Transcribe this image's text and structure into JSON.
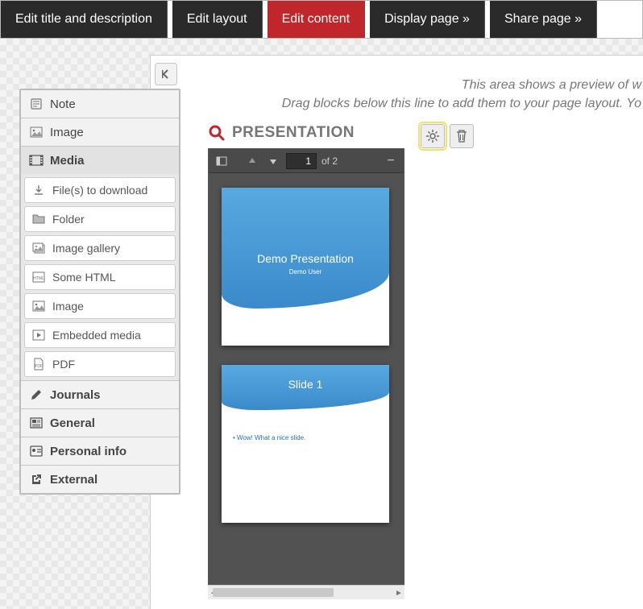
{
  "nav": {
    "tabs": [
      {
        "label": "Edit title and description",
        "active": false
      },
      {
        "label": "Edit layout",
        "active": false
      },
      {
        "label": "Edit content",
        "active": true
      },
      {
        "label": "Display page »",
        "active": false
      },
      {
        "label": "Share page »",
        "active": false
      }
    ]
  },
  "hint": {
    "line1": "This area shows a preview of w",
    "line2": "Drag blocks below this line to add them to your page layout. Yo"
  },
  "sidebar": {
    "cats": [
      {
        "icon": "note-icon",
        "label": "Note"
      },
      {
        "icon": "image-icon",
        "label": "Image"
      },
      {
        "icon": "media-icon",
        "label": "Media",
        "expanded": true,
        "subs": [
          {
            "icon": "download-icon",
            "label": "File(s) to download"
          },
          {
            "icon": "folder-icon",
            "label": "Folder"
          },
          {
            "icon": "gallery-icon",
            "label": "Image gallery"
          },
          {
            "icon": "html-icon",
            "label": "Some HTML"
          },
          {
            "icon": "image-icon",
            "label": "Image"
          },
          {
            "icon": "embed-icon",
            "label": "Embedded media"
          },
          {
            "icon": "pdf-icon",
            "label": "PDF"
          }
        ]
      },
      {
        "icon": "pencil-icon",
        "label": "Journals"
      },
      {
        "icon": "news-icon",
        "label": "General"
      },
      {
        "icon": "idcard-icon",
        "label": "Personal info"
      },
      {
        "icon": "external-icon",
        "label": "External"
      }
    ]
  },
  "block": {
    "title": "PRESENTATION",
    "gear_tip": "Configure",
    "trash_tip": "Delete"
  },
  "pdf": {
    "page": "1",
    "of": "of 2",
    "slide1_title": "Demo Presentation",
    "slide1_sub": "Demo User",
    "slide2_title": "Slide 1",
    "slide2_bullet": "Wow! What a nice slide."
  }
}
